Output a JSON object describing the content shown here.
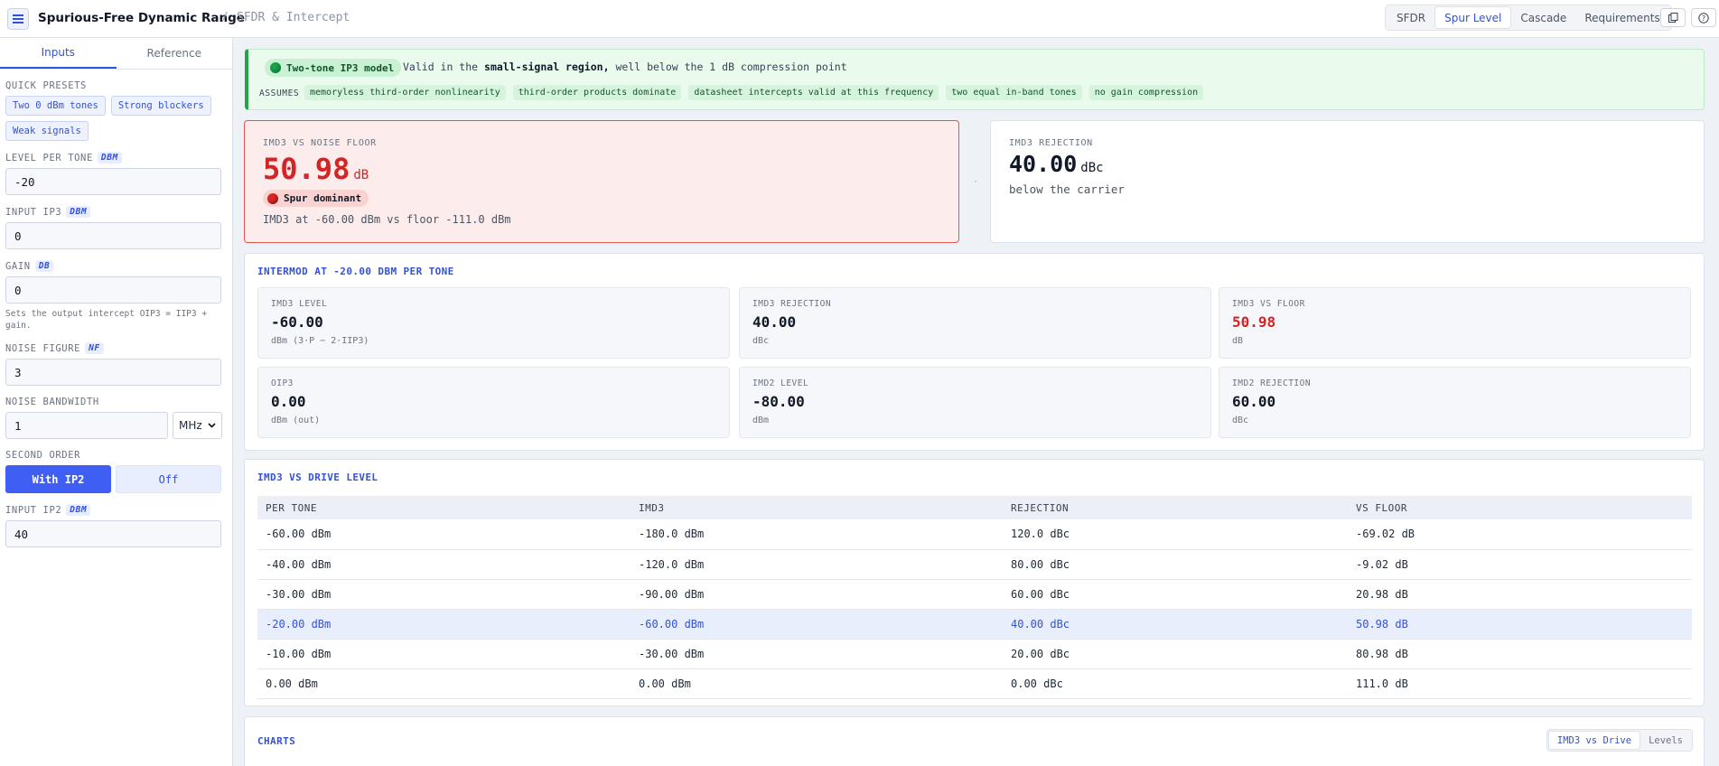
{
  "header": {
    "title": "Spurious-Free Dynamic Range",
    "separator": "/",
    "crumb": "SFDR & Intercept",
    "tabs": [
      {
        "label": "SFDR",
        "active": false
      },
      {
        "label": "Spur Level",
        "active": true
      },
      {
        "label": "Cascade",
        "active": false
      },
      {
        "label": "Requirements",
        "active": false
      }
    ]
  },
  "sidebar": {
    "tabs": [
      {
        "label": "Inputs",
        "active": true
      },
      {
        "label": "Reference",
        "active": false
      }
    ],
    "quick_presets_label": "QUICK PRESETS",
    "presets": [
      "Two 0 dBm tones",
      "Strong blockers",
      "Weak signals"
    ],
    "level_per_tone": {
      "label": "LEVEL PER TONE",
      "unit": "DBM",
      "value": "-20"
    },
    "input_ip3": {
      "label": "INPUT IP3",
      "unit": "DBM",
      "value": "0"
    },
    "gain": {
      "label": "GAIN",
      "unit": "DB",
      "value": "0",
      "hint": "Sets the output intercept OIP3 = IIP3 + gain."
    },
    "noise_figure": {
      "label": "NOISE FIGURE",
      "unit": "NF",
      "value": "3"
    },
    "noise_bandwidth": {
      "label": "NOISE BANDWIDTH",
      "value": "1",
      "unit_select": "MHz"
    },
    "second_order": {
      "label": "SECOND ORDER",
      "on_label": "With IP2",
      "off_label": "Off"
    },
    "input_ip2": {
      "label": "INPUT IP2",
      "unit": "DBM",
      "value": "40"
    }
  },
  "banner": {
    "model": "Two-tone IP3 model",
    "validity_pre": "Valid in the",
    "validity_bold": "small-signal region,",
    "validity_post": "well below the 1 dB compression point",
    "assumes_label": "ASSUMES",
    "assumes": [
      "memoryless third-order nonlinearity",
      "third-order products dominate",
      "datasheet intercepts valid at this frequency",
      "two equal in-band tones",
      "no gain compression"
    ]
  },
  "card_floor": {
    "label": "IMD3 VS NOISE FLOOR",
    "value": "50.98",
    "unit": "dB",
    "status": "Spur dominant",
    "note": "IMD3 at -60.00 dBm vs floor -111.0 dBm"
  },
  "card_rejection": {
    "label": "IMD3 REJECTION",
    "value": "40.00",
    "unit": "dBc",
    "note": "below the carrier"
  },
  "intermod": {
    "title": "INTERMOD AT -20.00 DBM PER TONE",
    "metrics": [
      {
        "label": "IMD3 LEVEL",
        "value": "-60.00",
        "sub": "dBm (3·P − 2·IIP3)",
        "alert": false
      },
      {
        "label": "IMD3 REJECTION",
        "value": "40.00",
        "sub": "dBc",
        "alert": false
      },
      {
        "label": "IMD3 VS FLOOR",
        "value": "50.98",
        "sub": "dB",
        "alert": true
      },
      {
        "label": "OIP3",
        "value": "0.00",
        "sub": "dBm (out)",
        "alert": false
      },
      {
        "label": "IMD2 LEVEL",
        "value": "-80.00",
        "sub": "dBm",
        "alert": false
      },
      {
        "label": "IMD2 REJECTION",
        "value": "60.00",
        "sub": "dBc",
        "alert": false
      }
    ]
  },
  "sweep": {
    "title": "IMD3 VS DRIVE LEVEL",
    "columns": [
      "PER TONE",
      "IMD3",
      "REJECTION",
      "VS FLOOR"
    ],
    "rows": [
      [
        "-60.00 dBm",
        "-180.0 dBm",
        "120.0 dBc",
        "-69.02 dB"
      ],
      [
        "-40.00 dBm",
        "-120.0 dBm",
        "80.00 dBc",
        "-9.02 dB"
      ],
      [
        "-30.00 dBm",
        "-90.00 dBm",
        "60.00 dBc",
        "20.98 dB"
      ],
      [
        "-20.00 dBm",
        "-60.00 dBm",
        "40.00 dBc",
        "50.98 dB"
      ],
      [
        "-10.00 dBm",
        "-30.00 dBm",
        "20.00 dBc",
        "80.98 dB"
      ],
      [
        "0.00 dBm",
        "0.00 dBm",
        "0.00 dBc",
        "111.0 dB"
      ]
    ],
    "highlight_row": 3
  },
  "charts": {
    "title": "CHARTS",
    "tabs": [
      {
        "label": "IMD3 vs Drive",
        "active": true
      },
      {
        "label": "Levels",
        "active": false
      }
    ]
  },
  "colors": {
    "accent": "#3452d6",
    "alert": "#d42424",
    "ok": "#16a34a"
  }
}
